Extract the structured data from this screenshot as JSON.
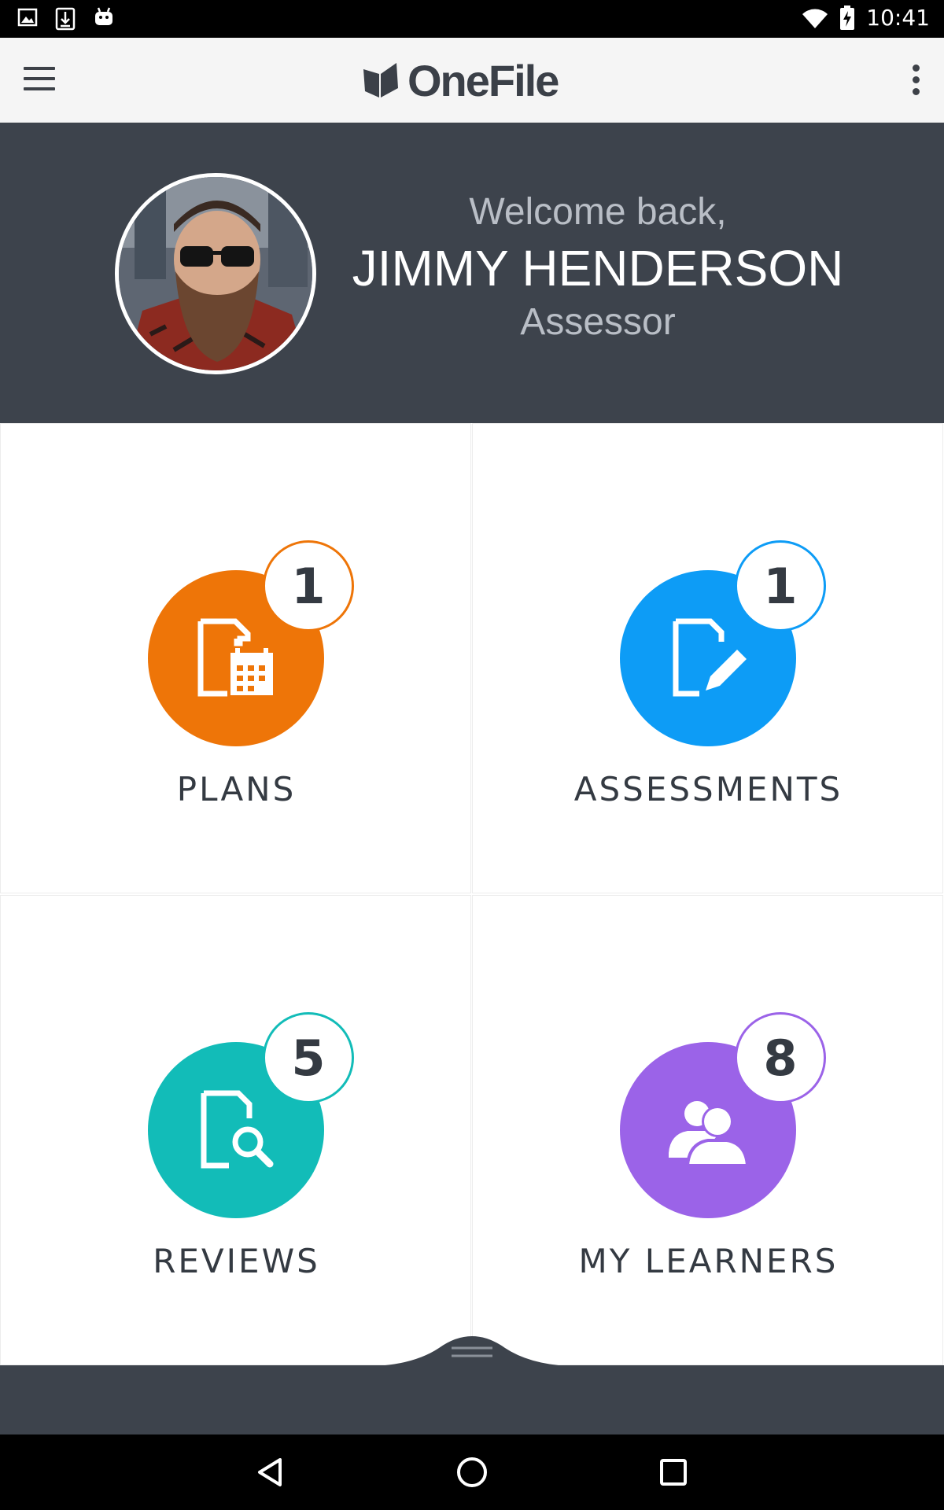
{
  "status_bar": {
    "time": "10:41",
    "icons": [
      "image-icon",
      "download-icon",
      "android-icon",
      "wifi-icon",
      "battery-charging-icon"
    ]
  },
  "app_bar": {
    "logo_text": "OneFile",
    "menu_icon": "hamburger-menu-icon",
    "overflow_icon": "more-vertical-icon"
  },
  "profile": {
    "welcome": "Welcome back,",
    "name": "JIMMY HENDERSON",
    "role": "Assessor"
  },
  "tiles": [
    {
      "label": "PLANS",
      "count": "1",
      "color": "#ee7508",
      "icon": "document-calendar-icon"
    },
    {
      "label": "ASSESSMENTS",
      "count": "1",
      "color": "#0d9cf6",
      "icon": "document-edit-icon"
    },
    {
      "label": "REVIEWS",
      "count": "5",
      "color": "#12bcb8",
      "icon": "document-search-icon"
    },
    {
      "label": "MY LEARNERS",
      "count": "8",
      "color": "#9b63e8",
      "icon": "users-icon"
    }
  ],
  "colors": {
    "header_bg": "#3d434c",
    "app_bar_bg": "#f5f5f5",
    "text_dark": "#343a42"
  }
}
